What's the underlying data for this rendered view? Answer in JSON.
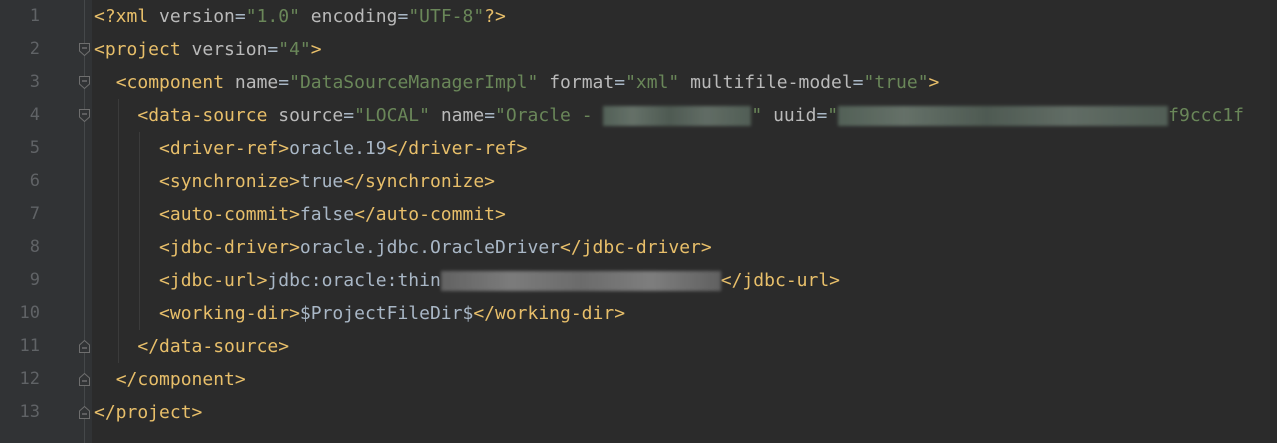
{
  "editor": {
    "lines": [
      {
        "num": "1",
        "parts": [
          [
            "t",
            "<?xml"
          ],
          [
            "x",
            " "
          ],
          [
            "a",
            "version"
          ],
          [
            "x",
            "="
          ],
          [
            "v",
            "\"1.0\""
          ],
          [
            "x",
            " "
          ],
          [
            "a",
            "encoding"
          ],
          [
            "x",
            "="
          ],
          [
            "v",
            "\"UTF-8\""
          ],
          [
            "t",
            "?>"
          ]
        ]
      },
      {
        "num": "2",
        "parts": [
          [
            "t",
            "<project"
          ],
          [
            "x",
            " "
          ],
          [
            "a",
            "version"
          ],
          [
            "x",
            "="
          ],
          [
            "v",
            "\"4\""
          ],
          [
            "t",
            ">"
          ]
        ]
      },
      {
        "num": "3",
        "parts": [
          [
            "x",
            "  "
          ],
          [
            "t",
            "<component"
          ],
          [
            "x",
            " "
          ],
          [
            "a",
            "name"
          ],
          [
            "x",
            "="
          ],
          [
            "v",
            "\"DataSourceManagerImpl\""
          ],
          [
            "x",
            " "
          ],
          [
            "a",
            "format"
          ],
          [
            "x",
            "="
          ],
          [
            "v",
            "\"xml\""
          ],
          [
            "x",
            " "
          ],
          [
            "a",
            "multifile-model"
          ],
          [
            "x",
            "="
          ],
          [
            "v",
            "\"true\""
          ],
          [
            "t",
            ">"
          ]
        ]
      },
      {
        "num": "4",
        "parts": [
          [
            "x",
            "    "
          ],
          [
            "t",
            "<data-source"
          ],
          [
            "x",
            " "
          ],
          [
            "a",
            "source"
          ],
          [
            "x",
            "="
          ],
          [
            "v",
            "\"LOCAL\""
          ],
          [
            "x",
            " "
          ],
          [
            "a",
            "name"
          ],
          [
            "x",
            "="
          ],
          [
            "v",
            "\"Oracle - "
          ],
          [
            "r",
            "148"
          ],
          [
            "v",
            "\""
          ],
          [
            "x",
            " "
          ],
          [
            "a",
            "uuid"
          ],
          [
            "x",
            "="
          ],
          [
            "v",
            "\""
          ],
          [
            "r",
            "330"
          ],
          [
            "v",
            "f9ccc1f"
          ]
        ]
      },
      {
        "num": "5",
        "parts": [
          [
            "x",
            "      "
          ],
          [
            "t",
            "<driver-ref>"
          ],
          [
            "x",
            "oracle.19"
          ],
          [
            "t",
            "</driver-ref>"
          ]
        ]
      },
      {
        "num": "6",
        "parts": [
          [
            "x",
            "      "
          ],
          [
            "t",
            "<synchronize>"
          ],
          [
            "x",
            "true"
          ],
          [
            "t",
            "</synchronize>"
          ]
        ]
      },
      {
        "num": "7",
        "parts": [
          [
            "x",
            "      "
          ],
          [
            "t",
            "<auto-commit>"
          ],
          [
            "x",
            "false"
          ],
          [
            "t",
            "</auto-commit>"
          ]
        ]
      },
      {
        "num": "8",
        "parts": [
          [
            "x",
            "      "
          ],
          [
            "t",
            "<jdbc-driver>"
          ],
          [
            "x",
            "oracle.jdbc.OracleDriver"
          ],
          [
            "t",
            "</jdbc-driver>"
          ]
        ]
      },
      {
        "num": "9",
        "parts": [
          [
            "x",
            "      "
          ],
          [
            "t",
            "<jdbc-url>"
          ],
          [
            "x",
            "jdbc:oracle:thin"
          ],
          [
            "rl",
            "280"
          ],
          [
            "t",
            "</jdbc-url>"
          ]
        ]
      },
      {
        "num": "10",
        "parts": [
          [
            "x",
            "      "
          ],
          [
            "t",
            "<working-dir>"
          ],
          [
            "x",
            "$ProjectFileDir$"
          ],
          [
            "t",
            "</working-dir>"
          ]
        ]
      },
      {
        "num": "11",
        "parts": [
          [
            "x",
            "    "
          ],
          [
            "t",
            "</data-source>"
          ]
        ]
      },
      {
        "num": "12",
        "parts": [
          [
            "x",
            "  "
          ],
          [
            "t",
            "</component>"
          ]
        ]
      },
      {
        "num": "13",
        "parts": [
          [
            "t",
            "</project>"
          ]
        ]
      }
    ],
    "folds": {
      "2": "open",
      "3": "open",
      "4": "open",
      "11": "close",
      "12": "close",
      "13": "close"
    },
    "colors": {
      "background": "#2b2b2b",
      "gutter": "#313335",
      "tag": "#e8bf6a",
      "attribute": "#bababa",
      "value": "#6a8759",
      "text": "#a9b7c6",
      "line_number": "#606366"
    }
  }
}
